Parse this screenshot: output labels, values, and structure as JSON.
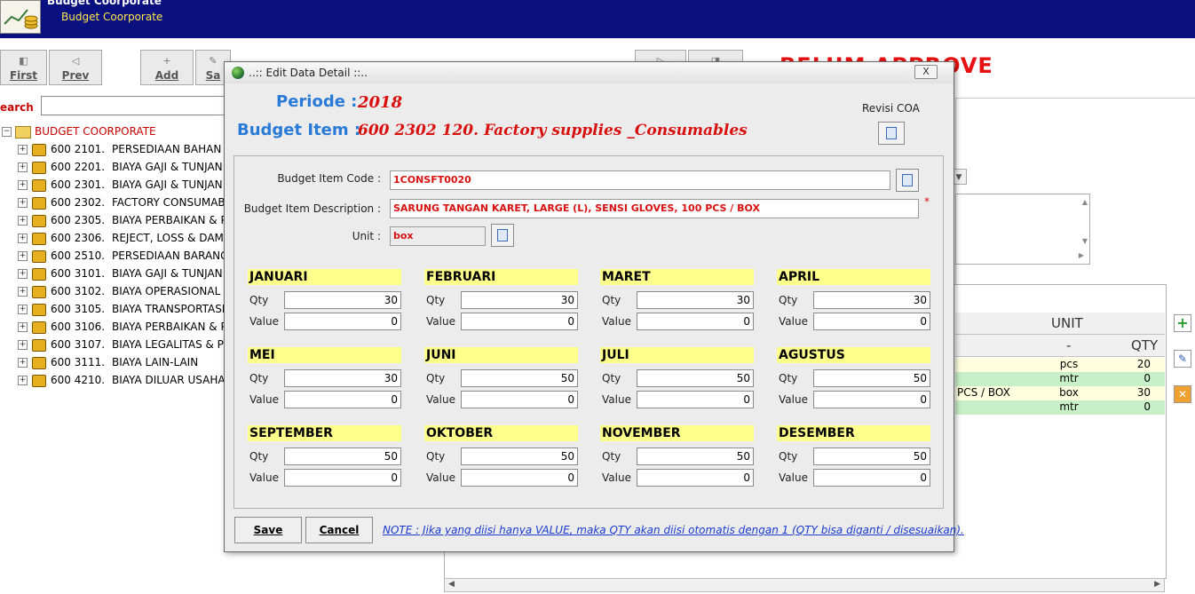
{
  "app": {
    "title": "Budget Coorporate",
    "subtitle": "Budget Coorporate"
  },
  "toolbar": {
    "first": "First",
    "prev": "Prev",
    "add": "Add",
    "save_partial": "Sa"
  },
  "search": {
    "label": "earch",
    "value": ""
  },
  "status_banner": "BELUM APPROVE",
  "tree": {
    "root": "BUDGET COORPORATE",
    "items": [
      {
        "code": "600 2101.",
        "name": "PERSEDIAAN BAHAN BA"
      },
      {
        "code": "600 2201.",
        "name": "BIAYA GAJI & TUNJAN"
      },
      {
        "code": "600 2301.",
        "name": "BIAYA GAJI & TUNJAN"
      },
      {
        "code": "600 2302.",
        "name": "FACTORY CONSUMABL"
      },
      {
        "code": "600 2305.",
        "name": "BIAYA PERBAIKAN & P"
      },
      {
        "code": "600 2306.",
        "name": "REJECT, LOSS & DAMA"
      },
      {
        "code": "600 2510.",
        "name": "PERSEDIAAN BARANG J"
      },
      {
        "code": "600 3101.",
        "name": "BIAYA GAJI & TUNJAN"
      },
      {
        "code": "600 3102.",
        "name": "BIAYA OPERASIONAL K"
      },
      {
        "code": "600 3105.",
        "name": "BIAYA TRANSPORTASI"
      },
      {
        "code": "600 3106.",
        "name": "BIAYA PERBAIKAN & P"
      },
      {
        "code": "600 3107.",
        "name": "BIAYA LEGALITAS & P"
      },
      {
        "code": "600 3111.",
        "name": "BIAYA LAIN-LAIN"
      },
      {
        "code": "600 4210.",
        "name": "BIAYA DILUAR USAHA."
      }
    ]
  },
  "grid": {
    "col_unit": "UNIT",
    "col_qty": "QTY",
    "unit_dash": "-",
    "rows": [
      {
        "desc": "",
        "unit": "pcs",
        "qty": "20"
      },
      {
        "desc": "",
        "unit": "mtr",
        "qty": "0"
      },
      {
        "desc": "PCS / BOX",
        "unit": "box",
        "qty": "30"
      },
      {
        "desc": "",
        "unit": "mtr",
        "qty": "0"
      }
    ]
  },
  "dialog": {
    "title": "..:: Edit Data Detail ::..",
    "close": "X",
    "periode_label": "Periode :",
    "periode_value": "2018",
    "budget_item_label": "Budget Item :",
    "budget_item_value": "600 2302 120.  Factory supplies _Consumables",
    "revisi_label": "Revisi COA",
    "code_label": "Budget Item Code :",
    "code_value": "1CONSFT0020",
    "desc_label": "Budget Item Description :",
    "desc_value": "SARUNG TANGAN KARET, LARGE (L), SENSI GLOVES, 100 PCS / BOX",
    "required_mark": "*",
    "unit_label": "Unit :",
    "unit_value": "box",
    "qty_label": "Qty",
    "value_label": "Value",
    "months": [
      {
        "name": "JANUARI",
        "qty": "30",
        "value": "0"
      },
      {
        "name": "FEBRUARI",
        "qty": "30",
        "value": "0"
      },
      {
        "name": "MARET",
        "qty": "30",
        "value": "0"
      },
      {
        "name": "APRIL",
        "qty": "30",
        "value": "0"
      },
      {
        "name": "MEI",
        "qty": "30",
        "value": "0"
      },
      {
        "name": "JUNI",
        "qty": "50",
        "value": "0"
      },
      {
        "name": "JULI",
        "qty": "50",
        "value": "0"
      },
      {
        "name": "AGUSTUS",
        "qty": "50",
        "value": "0"
      },
      {
        "name": "SEPTEMBER",
        "qty": "50",
        "value": "0"
      },
      {
        "name": "OKTOBER",
        "qty": "50",
        "value": "0"
      },
      {
        "name": "NOVEMBER",
        "qty": "50",
        "value": "0"
      },
      {
        "name": "DESEMBER",
        "qty": "50",
        "value": "0"
      }
    ],
    "save": "Save",
    "cancel": "Cancel",
    "note": "NOTE : Jika yang diisi hanya VALUE, maka QTY akan diisi otomatis dengan 1 (QTY bisa diganti / disesuaikan)."
  }
}
